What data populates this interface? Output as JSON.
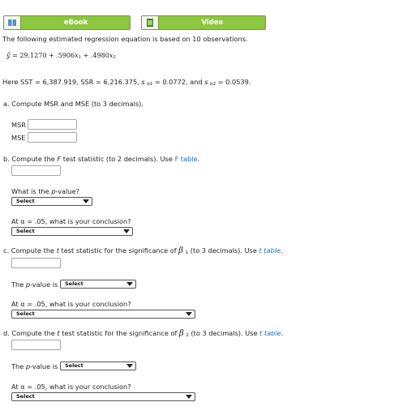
{
  "toolbar": {
    "ebook_label": "eBook",
    "video_label": "Video"
  },
  "intro": "The following estimated regression equation is based on 10 observations.",
  "equation": {
    "yhat": "ŷ",
    "rhs_a": " = 29.1270 + .5906",
    "x": "x",
    "sub1": "1",
    "rhs_b": " + .4980",
    "sub2": "2"
  },
  "stats": {
    "prefix": "Here SST = 6,387.919, SSR = 6,216.375, ",
    "s": "s",
    "b1": "b1",
    "mid": " = 0.0772, and ",
    "b2": "b2",
    "end": " = 0.0539."
  },
  "part_a": {
    "marker": "a.",
    "question": "Compute MSR and MSE (to 3 decimals).",
    "msr_label": "MSR",
    "mse_label": "MSE"
  },
  "part_b": {
    "marker": "b.",
    "q_pre": "Compute the ",
    "F": "F",
    "q_mid": " test statistic (to 2 decimals). Use ",
    "link": "F table",
    "q_end": ".",
    "p_pre": "What is the ",
    "p_it": "p",
    "p_end": "-value?",
    "p_select": "Select",
    "alpha_text": "At α = .05, what is your conclusion?",
    "concl_select": "Select"
  },
  "part_c": {
    "marker": "c.",
    "q_pre": "Compute the ",
    "t": "t",
    "q_mid": " test statistic for the significance of ",
    "beta": "β",
    "sub": "1",
    "q_mid2": " (to 3 decimals). Use ",
    "link": "t table",
    "q_end": ".",
    "p_pre": "The ",
    "p_it": "p",
    "p_end": "-value is",
    "p_select": "Select",
    "alpha_text": "At α = .05, what is your conclusion?",
    "concl_select": "Select"
  },
  "part_d": {
    "marker": "d.",
    "q_pre": "Compute the ",
    "t": "t",
    "q_mid": " test statistic for the significance of ",
    "beta": "β",
    "sub": "2",
    "q_mid2": " (to 3 decimals). Use ",
    "link": "t table",
    "q_end": ".",
    "p_pre": "The ",
    "p_it": "p",
    "p_end": "-value is",
    "p_select": "Select",
    "alpha_text": "At α = .05, what is your conclusion?",
    "concl_select": "Select"
  }
}
